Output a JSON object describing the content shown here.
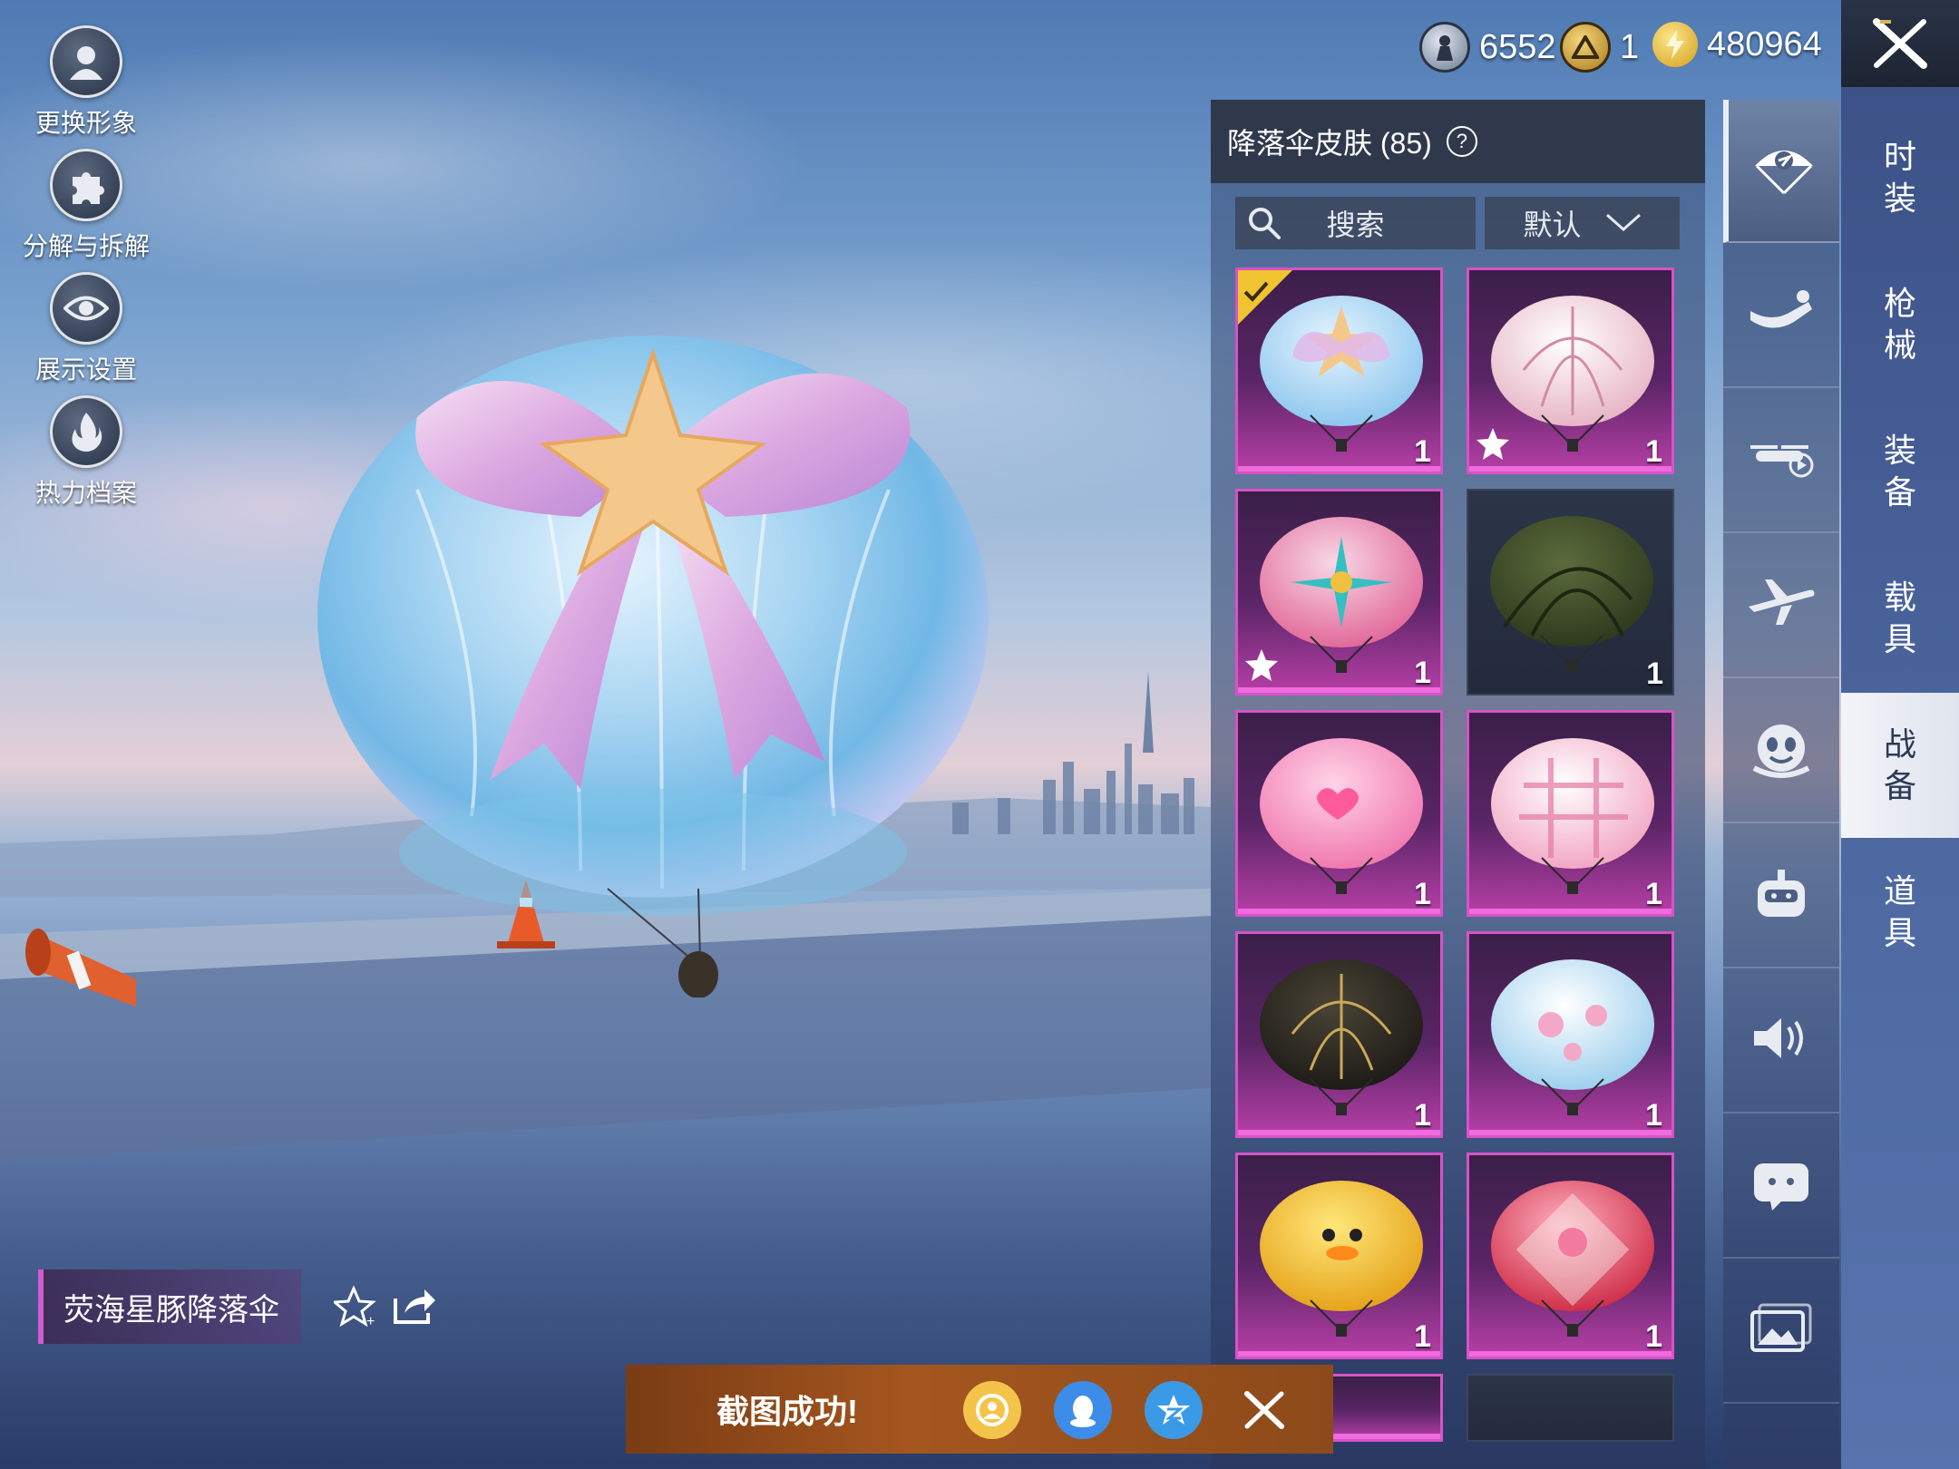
{
  "currency": [
    {
      "icon": "silver-coin-icon",
      "value": "6552"
    },
    {
      "icon": "gold-badge-icon",
      "value": "1"
    },
    {
      "icon": "lightning-coin-icon",
      "value": "480964"
    }
  ],
  "left_actions": [
    {
      "icon": "avatar-icon",
      "label": "更换形象"
    },
    {
      "icon": "puzzle-icon",
      "label": "分解与拆解"
    },
    {
      "icon": "eye-icon",
      "label": "展示设置"
    },
    {
      "icon": "flame-icon",
      "label": "热力档案"
    }
  ],
  "panel": {
    "title": "降落伞皮肤 (85)",
    "help": "?",
    "search_label": "搜索",
    "sort_label": "默认"
  },
  "items": [
    {
      "count": "1",
      "rarity": "pink",
      "equipped": true,
      "favorite": false,
      "art": "crystal-bow"
    },
    {
      "count": "1",
      "rarity": "pink",
      "equipped": false,
      "favorite": true,
      "art": "pink-stripe"
    },
    {
      "count": "1",
      "rarity": "pink",
      "equipped": false,
      "favorite": true,
      "art": "compass-pink"
    },
    {
      "count": "1",
      "rarity": "dark",
      "equipped": false,
      "favorite": false,
      "art": "olive-green"
    },
    {
      "count": "1",
      "rarity": "pink",
      "equipped": false,
      "favorite": false,
      "art": "heart-wing"
    },
    {
      "count": "1",
      "rarity": "pink",
      "equipped": false,
      "favorite": false,
      "art": "pink-plaid"
    },
    {
      "count": "1",
      "rarity": "pink",
      "equipped": false,
      "favorite": false,
      "art": "black-gold"
    },
    {
      "count": "1",
      "rarity": "pink",
      "equipped": false,
      "favorite": false,
      "art": "blue-floral"
    },
    {
      "count": "1",
      "rarity": "pink",
      "equipped": false,
      "favorite": false,
      "art": "yellow-duck"
    },
    {
      "count": "1",
      "rarity": "pink",
      "equipped": false,
      "favorite": false,
      "art": "red-box"
    }
  ],
  "side_icons": [
    "parachute-icon",
    "skydiver-icon",
    "aircraft-icon",
    "airplane-icon",
    "face-emote-icon",
    "robot-icon",
    "speaker-icon",
    "chat-bubble-icon",
    "gallery-icon"
  ],
  "categories": [
    "时装",
    "枪械",
    "装备",
    "载具",
    "战备",
    "道具"
  ],
  "active_category": "战备",
  "item_name": "荧海星豚降落伞",
  "toast": {
    "text": "截图成功!"
  },
  "share_icons": [
    "game-share-icon",
    "qq-icon",
    "qzone-icon",
    "x-share-icon"
  ]
}
